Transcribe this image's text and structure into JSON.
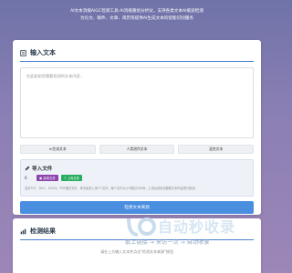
{
  "header": {
    "line1": "AI文本消痕AIGC检测工具-AI消痕重组分析仪，支持各类文本AI痕迹检测",
    "line2": "为论文、稿件、文章、简历等提供AI生成文本的智能识别服务"
  },
  "input_section": {
    "title": "输入文本",
    "placeholder": "在此粘贴您需要检测的文本内容...",
    "buttons": [
      "AI生成文本",
      "人类创作文本",
      "混合文本"
    ]
  },
  "upload_section": {
    "title": "导入文件",
    "count": "0",
    "select_button": "选择文件",
    "upload_button": "上传文件",
    "note": "支持TXT、DOC、DOCX、PDF格式文件，单次最多上传5个文件，每个文件大小不超过10MB，上传后将自动提取文本内容进行检测。"
  },
  "primary_button": "检测文本来源",
  "result_section": {
    "title": "检测结果",
    "placeholder": "请在上方输入文本并点击\"检测文本来源\"按钮"
  },
  "watermark": {
    "brand": "自动秒收录",
    "tagline": "散上链接 → 来访一次 → 自动收录"
  },
  "colors": {
    "accent": "#4a8ee0",
    "upload_purple": "#8e44ad",
    "upload_green": "#27ae60"
  }
}
